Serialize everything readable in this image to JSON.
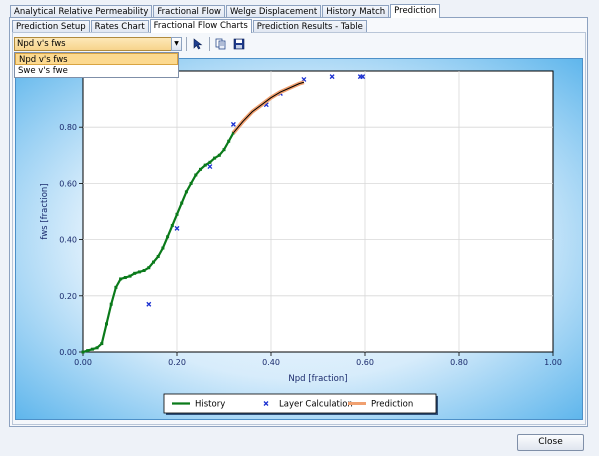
{
  "main_tabs": [
    {
      "label": "Analytical Relative Permeability",
      "active": false
    },
    {
      "label": "Fractional Flow",
      "active": false
    },
    {
      "label": "Welge Displacement",
      "active": false
    },
    {
      "label": "History Match",
      "active": false
    },
    {
      "label": "Prediction",
      "active": true
    }
  ],
  "sub_tabs": [
    {
      "label": "Prediction Setup",
      "active": false
    },
    {
      "label": "Rates Chart",
      "active": false
    },
    {
      "label": "Fractional Flow Charts",
      "active": true
    },
    {
      "label": "Prediction Results - Table",
      "active": false
    }
  ],
  "toolbar": {
    "chart_select_value": "Npd v's fws",
    "icons": [
      "pointer-icon",
      "copy-icon",
      "save-icon"
    ]
  },
  "dropdown": {
    "options": [
      "Npd v's fws",
      "Swe v's fwe"
    ],
    "selected": "Npd v's fws"
  },
  "close_label": "Close",
  "colors": {
    "history": "#0a7a1a",
    "layer": "#1a2fd0",
    "prediction": "#f0a070",
    "prediction_core": "#000000"
  },
  "chart_data": {
    "type": "scatter",
    "xlabel": "Npd [fraction]",
    "ylabel": "fws [fraction]",
    "xlim": [
      0,
      1
    ],
    "ylim": [
      0,
      1.0
    ],
    "x_ticks": [
      "0.00",
      "0.20",
      "0.40",
      "0.60",
      "0.80",
      "1.00"
    ],
    "y_ticks": [
      "0.00",
      "0.20",
      "0.40",
      "0.60",
      "0.80"
    ],
    "grid": true,
    "legend_position": "bottom",
    "series": [
      {
        "name": "History",
        "kind": "line-markers",
        "points": [
          [
            0.0,
            0.0
          ],
          [
            0.01,
            0.005
          ],
          [
            0.02,
            0.01
          ],
          [
            0.03,
            0.015
          ],
          [
            0.04,
            0.03
          ],
          [
            0.05,
            0.1
          ],
          [
            0.06,
            0.17
          ],
          [
            0.07,
            0.23
          ],
          [
            0.08,
            0.26
          ],
          [
            0.09,
            0.265
          ],
          [
            0.1,
            0.27
          ],
          [
            0.11,
            0.28
          ],
          [
            0.12,
            0.285
          ],
          [
            0.13,
            0.29
          ],
          [
            0.14,
            0.3
          ],
          [
            0.15,
            0.32
          ],
          [
            0.16,
            0.34
          ],
          [
            0.17,
            0.37
          ],
          [
            0.18,
            0.41
          ],
          [
            0.19,
            0.45
          ],
          [
            0.2,
            0.49
          ],
          [
            0.21,
            0.53
          ],
          [
            0.22,
            0.57
          ],
          [
            0.23,
            0.6
          ],
          [
            0.24,
            0.63
          ],
          [
            0.25,
            0.65
          ],
          [
            0.26,
            0.665
          ],
          [
            0.27,
            0.675
          ],
          [
            0.28,
            0.69
          ],
          [
            0.29,
            0.7
          ],
          [
            0.3,
            0.72
          ],
          [
            0.31,
            0.75
          ],
          [
            0.32,
            0.78
          ]
        ]
      },
      {
        "name": "Layer Calculation",
        "kind": "markers",
        "points": [
          [
            0.14,
            0.17
          ],
          [
            0.2,
            0.44
          ],
          [
            0.27,
            0.66
          ],
          [
            0.32,
            0.81
          ],
          [
            0.39,
            0.88
          ],
          [
            0.42,
            0.92
          ],
          [
            0.47,
            0.97
          ],
          [
            0.53,
            0.98
          ],
          [
            0.59,
            0.98
          ],
          [
            0.595,
            0.98
          ]
        ]
      },
      {
        "name": "Prediction",
        "kind": "line",
        "points": [
          [
            0.32,
            0.78
          ],
          [
            0.34,
            0.82
          ],
          [
            0.36,
            0.855
          ],
          [
            0.38,
            0.88
          ],
          [
            0.4,
            0.905
          ],
          [
            0.42,
            0.925
          ],
          [
            0.44,
            0.94
          ],
          [
            0.46,
            0.955
          ],
          [
            0.47,
            0.96
          ]
        ]
      }
    ]
  }
}
